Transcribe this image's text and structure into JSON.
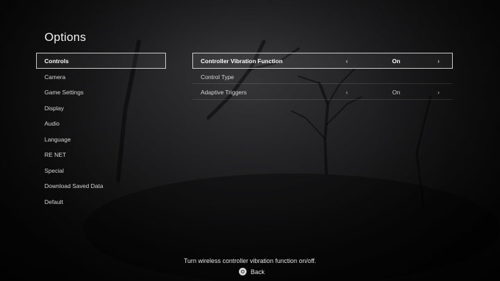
{
  "title": "Options",
  "menu": {
    "items": [
      {
        "label": "Controls",
        "active": true
      },
      {
        "label": "Camera"
      },
      {
        "label": "Game Settings"
      },
      {
        "label": "Display"
      },
      {
        "label": "Audio"
      },
      {
        "label": "Language"
      },
      {
        "label": "RE NET"
      },
      {
        "label": "Special"
      },
      {
        "label": "Download Saved Data"
      },
      {
        "label": "Default"
      }
    ]
  },
  "options": {
    "rows": [
      {
        "label": "Controller Vibration Function",
        "value": "On",
        "left_arrow": "‹",
        "right_arrow": "›",
        "active": true
      },
      {
        "label": "Control Type"
      },
      {
        "label": "Adaptive Triggers",
        "value": "On",
        "left_arrow": "‹",
        "right_arrow": "›"
      }
    ]
  },
  "footer": {
    "hint": "Turn wireless controller vibration function on/off.",
    "back_label": "Back",
    "back_icon": "circle-button-icon"
  }
}
